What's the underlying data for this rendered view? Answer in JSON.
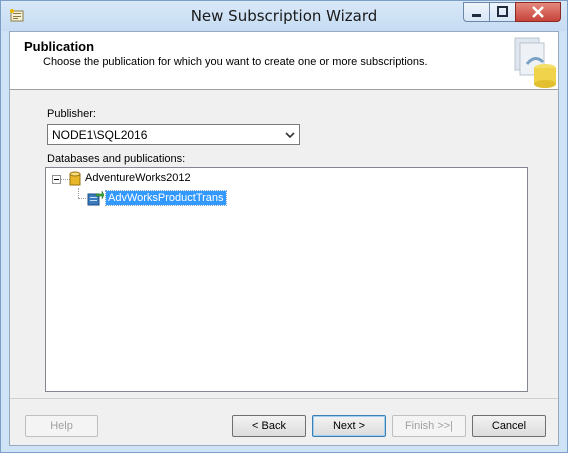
{
  "window": {
    "title": "New Subscription Wizard"
  },
  "header": {
    "title": "Publication",
    "description": "Choose the publication for which you want to create one or more subscriptions."
  },
  "publisher": {
    "label": "Publisher:",
    "value": "NODE1\\SQL2016"
  },
  "tree": {
    "label": "Databases and publications:",
    "database": "AdventureWorks2012",
    "publication": "AdvWorksProductTrans"
  },
  "buttons": {
    "help": "Help",
    "back": "< Back",
    "next": "Next >",
    "finish": "Finish >>|",
    "cancel": "Cancel"
  }
}
